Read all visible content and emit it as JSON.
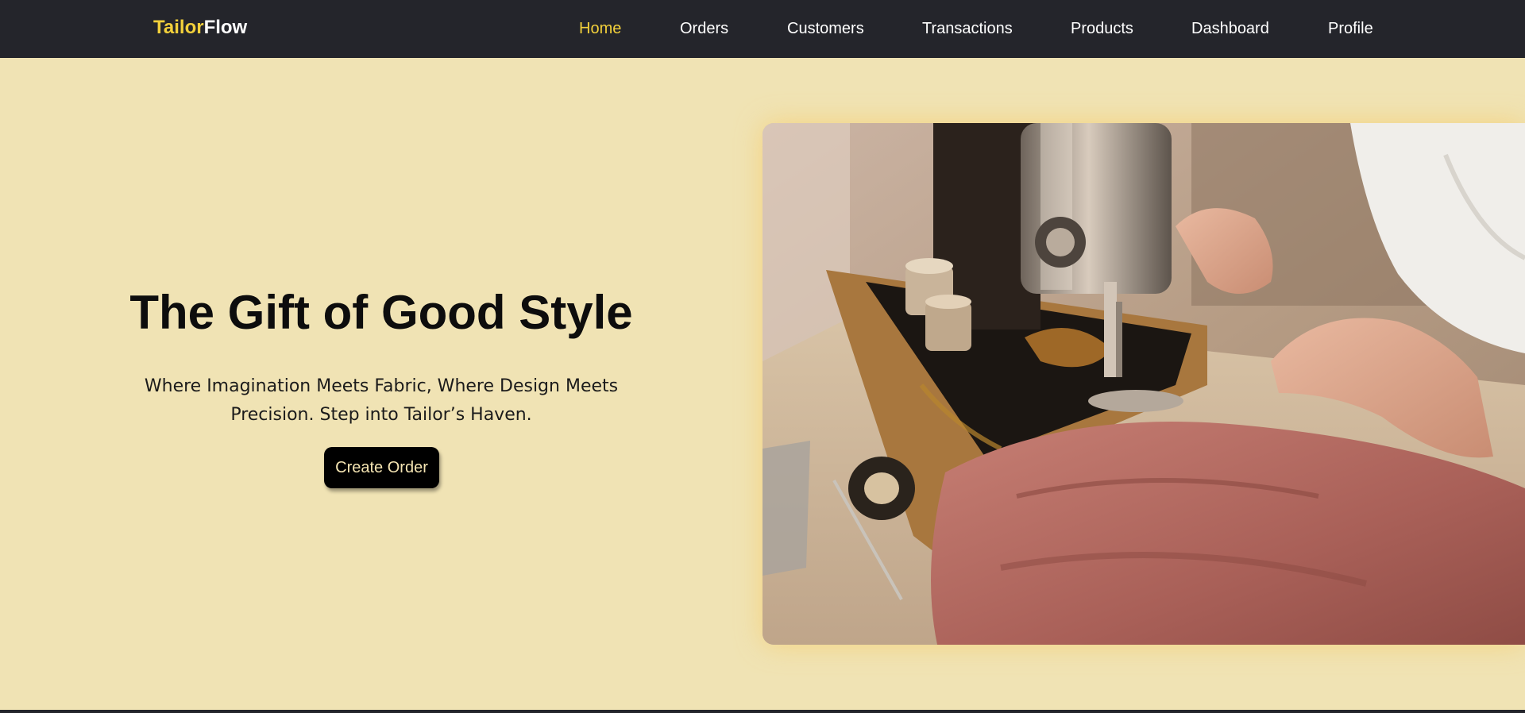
{
  "brand": {
    "part1": "Tailor",
    "part2": "Flow"
  },
  "nav": {
    "items": [
      {
        "label": "Home",
        "active": true
      },
      {
        "label": "Orders",
        "active": false
      },
      {
        "label": "Customers",
        "active": false
      },
      {
        "label": "Transactions",
        "active": false
      },
      {
        "label": "Products",
        "active": false
      },
      {
        "label": "Dashboard",
        "active": false
      },
      {
        "label": "Profile",
        "active": false
      }
    ]
  },
  "hero": {
    "title": "The Gift of Good Style",
    "subtitle": "Where Imagination Meets Fabric, Where Design Meets Precision. Step into Tailor’s Haven.",
    "cta_label": "Create Order"
  },
  "image": {
    "subject": "sewing-machine-photo"
  },
  "colors": {
    "navbar": "#24252b",
    "accent": "#f2d03b",
    "background": "#f0e3b4",
    "button": "#000000",
    "button_text": "#f4e4b2"
  }
}
